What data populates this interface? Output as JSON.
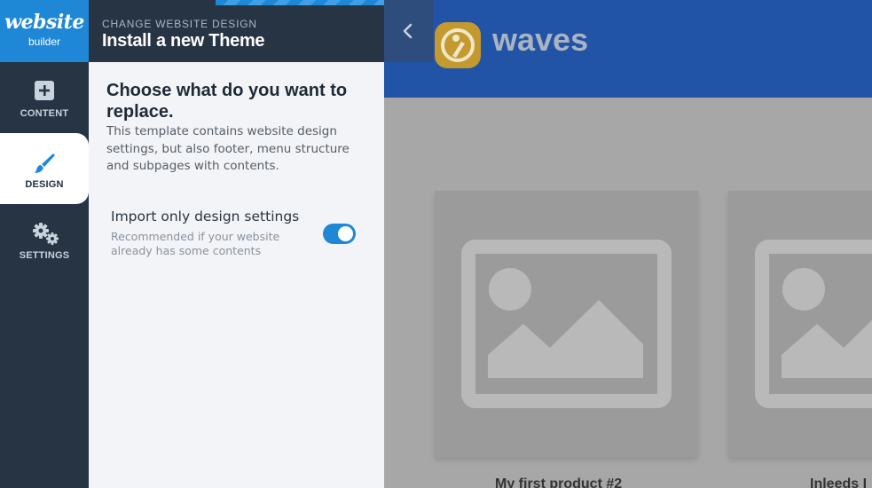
{
  "brand": {
    "logo_line1": "website",
    "logo_line2": "builder",
    "accent": "#1e88d6",
    "dark": "#273444"
  },
  "rail": {
    "items": [
      {
        "label": "CONTENT",
        "icon": "plus-square-icon",
        "active": false
      },
      {
        "label": "DESIGN",
        "icon": "paintbrush-icon",
        "active": true
      },
      {
        "label": "SETTINGS",
        "icon": "gears-icon",
        "active": false
      }
    ]
  },
  "panel": {
    "kicker": "CHANGE WEBSITE DESIGN",
    "title": "Install a new Theme",
    "heading": "Choose what do you want to replace.",
    "description": "This template contains website design settings, but also footer, menu structure and subpages with contents.",
    "option": {
      "title": "Import only design settings",
      "subtitle": "Recommended if your website already has some contents",
      "enabled": true
    }
  },
  "collapse": {
    "icon": "chevron-left-icon"
  },
  "preview": {
    "site_name": "waves",
    "header_color": "#2153a7",
    "products": [
      {
        "title": "My first product #2"
      },
      {
        "title": "Inleeds I"
      }
    ]
  }
}
